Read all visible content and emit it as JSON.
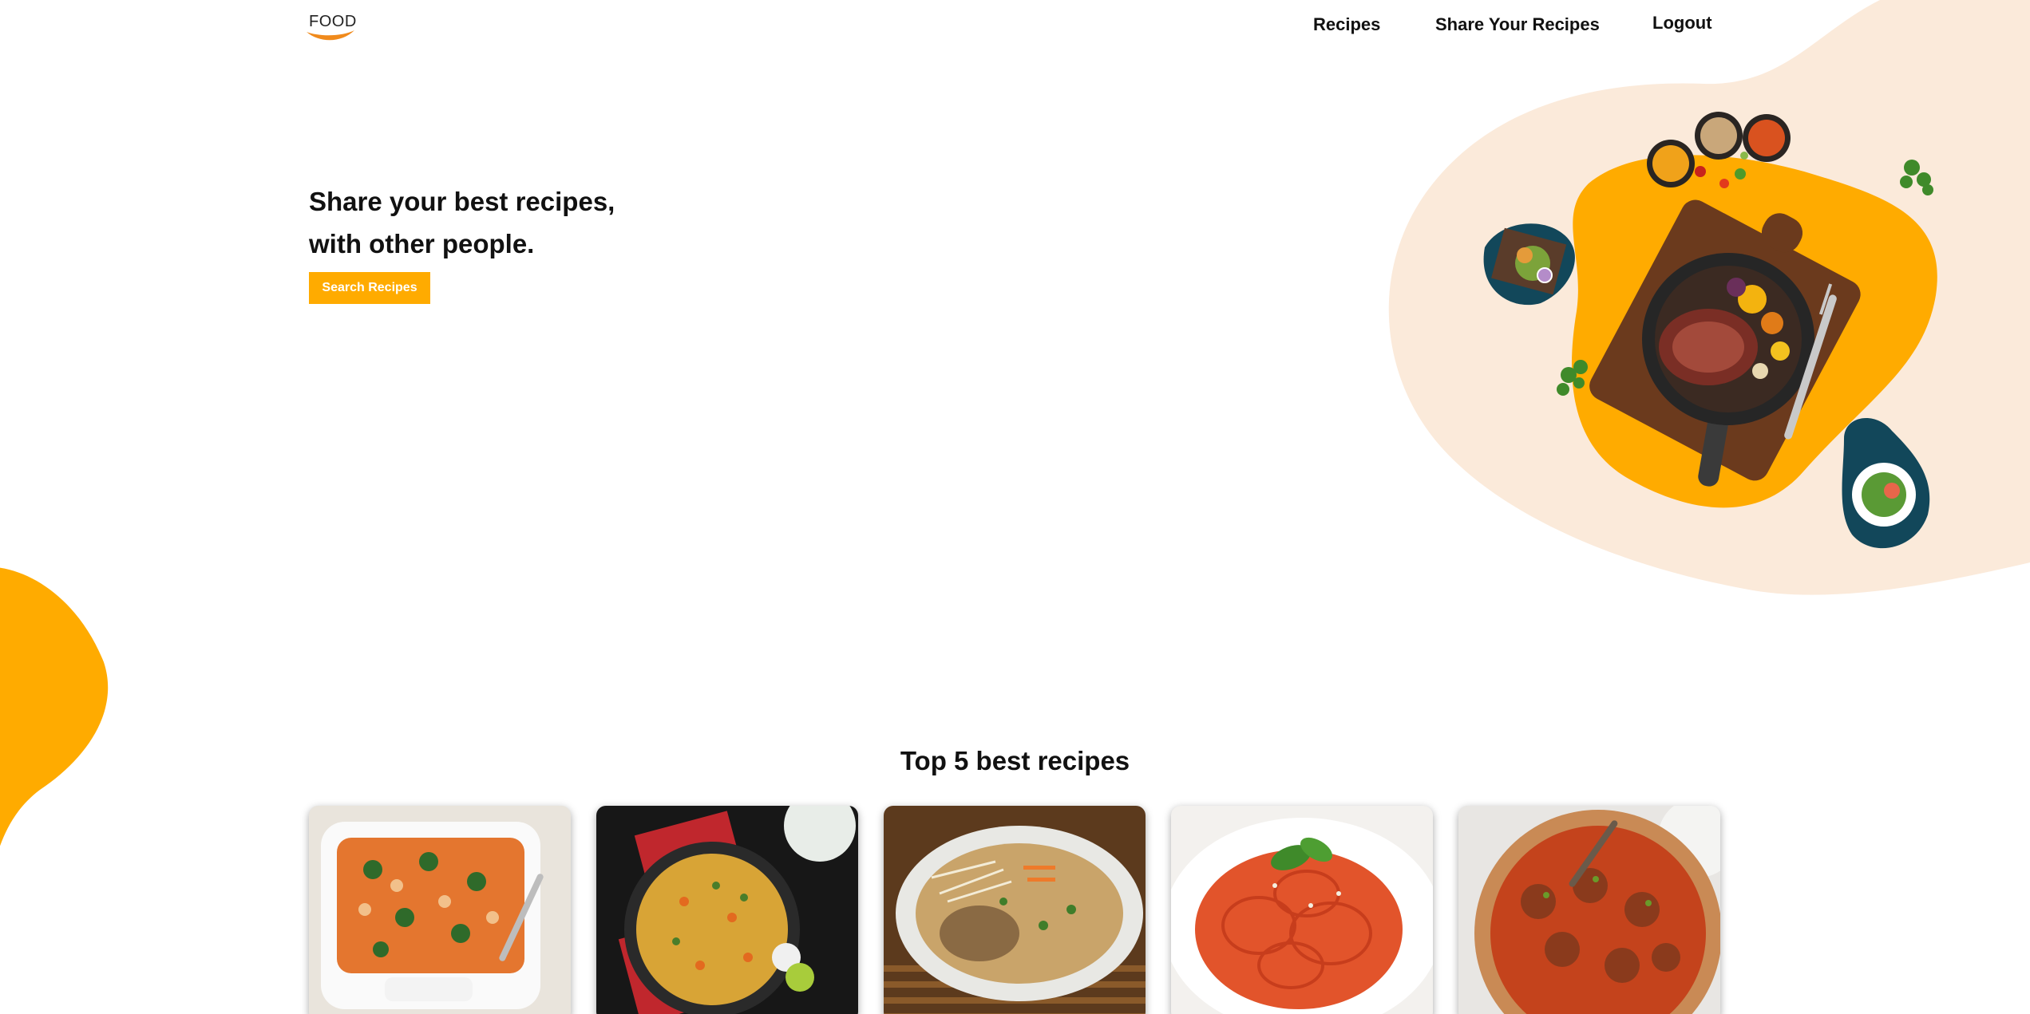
{
  "header": {
    "logo_text": "FOOD",
    "nav": {
      "recipes": "Recipes",
      "share": "Share Your Recipes",
      "logout": "Logout"
    }
  },
  "hero": {
    "title_line1": "Share your best recipes,",
    "title_line2": "with other people.",
    "search_button": "Search Recipes"
  },
  "top_recipes": {
    "title": "Top 5 best recipes",
    "items": [
      {
        "image": "baked-pasta-dish-image"
      },
      {
        "image": "biryani-rice-bowl-image"
      },
      {
        "image": "pad-thai-noodle-bowl-image"
      },
      {
        "image": "spaghetti-marinara-image"
      },
      {
        "image": "spaghetti-meatballs-image"
      }
    ]
  },
  "colors": {
    "accent": "#ffab00",
    "blob_light": "#fbeada",
    "teal": "#12475a",
    "logo_smile": "#f08a1c"
  }
}
